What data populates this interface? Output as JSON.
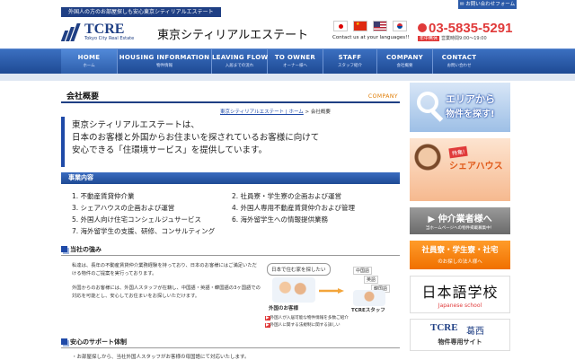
{
  "header": {
    "tagline": "外国人の方のお部屋探しも安心東京シティリアルエステート",
    "contact_button": "お問い合わせフォーム",
    "logo_abbr": "TCRE",
    "logo_en": "Tokyo City Real Estate",
    "logo_jp": "東京シティリアルエステート",
    "languages_text": "Contact us at your languages!!",
    "phone": "03-5835-5291",
    "hours_badge": "年中無休",
    "hours": "営業時間9:00〜19:00"
  },
  "nav": [
    {
      "en": "HOME",
      "jp": "ホーム"
    },
    {
      "en": "HOUSING INFORMATION",
      "jp": "物件情報"
    },
    {
      "en": "LEAVING FLOW",
      "jp": "入居までの流れ"
    },
    {
      "en": "TO OWNER",
      "jp": "オーナー様へ"
    },
    {
      "en": "STAFF",
      "jp": "スタッフ紹介"
    },
    {
      "en": "COMPANY",
      "jp": "会社概要"
    },
    {
      "en": "CONTACT",
      "jp": "お問い合わせ"
    }
  ],
  "page": {
    "title": "会社概要",
    "title_en": "COMPANY",
    "breadcrumb_link": "東京シティリアルエステート | ホーム",
    "breadcrumb_sep": " > ",
    "breadcrumb_current": "会社概要",
    "intro_lines": [
      "東京シティリアルエステートは、",
      "日本のお客様と外国からお住まいを探されているお客様に向けて",
      "安心できる「住環境サービス」を提供しています。"
    ]
  },
  "business": {
    "heading": "事業内容",
    "items": [
      "1.  不動産賃貸仲介業",
      "2.  社員寮・学生寮の企画および運営",
      "3.  シェアハウスの企画および運営",
      "4.  外国人専用不動産賃貸仲介および管理",
      "5.  外国人向け住宅コンシェルジュサービス",
      "6.  海外留学生への情報提供業務",
      "7.  海外留学生の支援、研修、コンサルティング"
    ]
  },
  "strengths": {
    "heading": "当社の強み",
    "paragraph1": "私達は、長年の不動産賃貸仲介業務経験を持っており、日本のお客様にはご満足いただける物件のご提案を実行っております。",
    "paragraph2": "外国からのお客様には、外国人スタッフが在籍し、中国語・英語・韓国語の3ヶ国語での対応を可能とし、安心してお住まいをお探しいただけます。",
    "figure": {
      "bubble": "日本で住む家を探したい",
      "customer_label": "外国のお客様",
      "staff_label": "TCREスタッフ",
      "lang_cn": "中国語",
      "lang_en": "英語",
      "lang_kr": "韓国語",
      "note1": "外国人が入居可能な物件情報を多数ご紹介",
      "note2": "外国人に関する法規制に関する詳しい"
    }
  },
  "support": {
    "heading": "安心のサポート体制",
    "text": "・お部屋探しから、当社外国人スタッフがお客様の母国語にて対応いたします。"
  },
  "sidebar": {
    "search_title": "エリアから",
    "search_sub": "物件を探す!",
    "share_badge": "特集!",
    "share_title": "シェアハウス",
    "agent_title": "仲介業者様へ",
    "agent_sub": "当ホームページへの物件掲載募集中！",
    "dorm_title": "社員寮・学生寮・社宅",
    "dorm_sub": "のお探しの法人様へ",
    "school_text": "日本語学校",
    "school_sub": "Japanese school",
    "kasai_logo": "TCRE",
    "kasai_jp": "葛西",
    "kasai_sub": "物件専用サイト"
  },
  "colors": {
    "brand_blue": "#1f3f84",
    "accent_red": "#e03a3a",
    "accent_orange": "#e07b00"
  }
}
